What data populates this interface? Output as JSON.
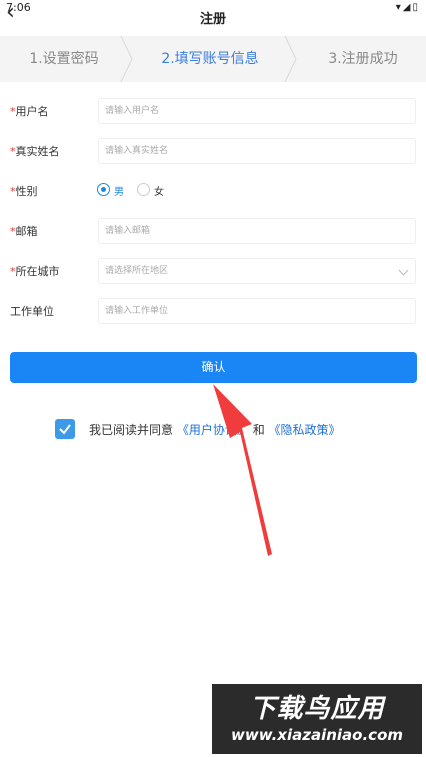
{
  "status_bar": {
    "time": "7:06",
    "icons": "▾◢▯"
  },
  "header": {
    "back_icon": "chevron-left",
    "title": "注册"
  },
  "steps": [
    {
      "label": "1.设置密码",
      "active": false
    },
    {
      "label": "2.填写账号信息",
      "active": true
    },
    {
      "label": "3.注册成功",
      "active": false
    }
  ],
  "form": {
    "required_mark": "*",
    "username": {
      "label": "用户名",
      "placeholder": "请输入用户名"
    },
    "realname": {
      "label": "真实姓名",
      "placeholder": "请输入真实姓名"
    },
    "gender": {
      "label": "性别",
      "options": [
        "男",
        "女"
      ],
      "selected": "男"
    },
    "email": {
      "label": "邮箱",
      "placeholder": "请输入邮箱"
    },
    "city": {
      "label": "所在城市",
      "placeholder": "请选择所在地区"
    },
    "workplace": {
      "label": "工作单位",
      "placeholder": "请输入工作单位"
    }
  },
  "confirm_label": "确认",
  "agreement": {
    "checked": true,
    "prefix": "我已阅读并同意",
    "user_agreement": "《用户协议》",
    "and": "和",
    "privacy_policy": "《隐私政策》"
  },
  "watermark": {
    "title": "下载鸟应用",
    "url": "www.xiazainiao.com"
  },
  "colors": {
    "primary": "#1a86f5",
    "link": "#1e6fd9",
    "required": "#e53935",
    "arrow": "#f03c3c"
  }
}
